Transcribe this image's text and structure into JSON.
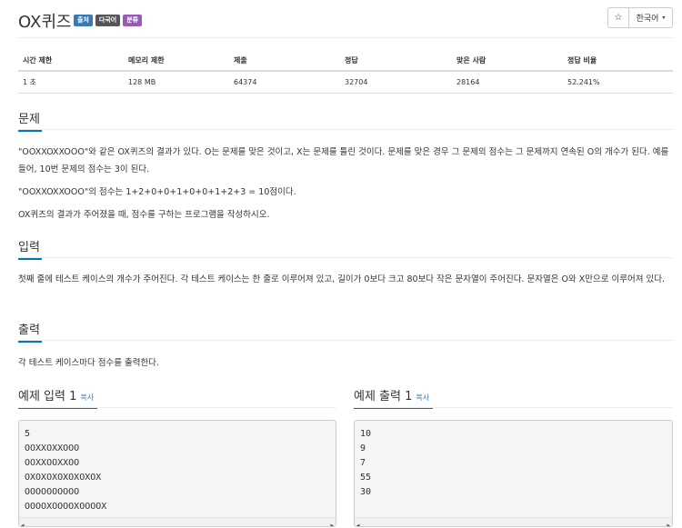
{
  "header": {
    "title": "OX퀴즈",
    "labels": [
      "출처",
      "다국어",
      "분류"
    ],
    "star_icon": "☆",
    "language": "한국어",
    "caret": "▾"
  },
  "info_table": {
    "headers": [
      "시간 제한",
      "메모리 제한",
      "제출",
      "정답",
      "맞은 사람",
      "정답 비율"
    ],
    "values": [
      "1 초",
      "128 MB",
      "64374",
      "32704",
      "28164",
      "52.241%"
    ]
  },
  "problem": {
    "title": "문제",
    "paragraphs": [
      "\"OOXXOXXOOO\"와 같은 OX퀴즈의 결과가 있다. O는 문제를 맞은 것이고, X는 문제를 틀린 것이다. 문제를 맞은 경우 그 문제의 점수는 그 문제까지 연속된 O의 개수가 된다. 예를 들어, 10번 문제의 점수는 3이 된다.",
      "\"OOXXOXXOOO\"의 점수는 1+2+0+0+1+0+0+1+2+3 = 10점이다.",
      "OX퀴즈의 결과가 주어졌을 때, 점수를 구하는 프로그램을 작성하시오."
    ]
  },
  "input": {
    "title": "입력",
    "text": "첫째 줄에 테스트 케이스의 개수가 주어진다. 각 테스트 케이스는 한 줄로 이루어져 있고, 길이가 0보다 크고 80보다 작은 문자열이 주어진다. 문자열은 O와 X만으로 이루어져 있다."
  },
  "output": {
    "title": "출력",
    "text": "각 테스트 케이스마다 점수를 출력한다."
  },
  "sample_input": {
    "title": "예제 입력 1",
    "copy": "복사",
    "lines": [
      "5",
      "OOXXOXXOOO",
      "OOXXOOXXOO",
      "OXOXOXOXOXOXOX",
      "OOOOOOOOOO",
      "OOOOXOOOOXOOOOX"
    ]
  },
  "sample_output": {
    "title": "예제 출력 1",
    "copy": "복사",
    "lines": [
      "10",
      "9",
      "7",
      "55",
      "30"
    ]
  }
}
